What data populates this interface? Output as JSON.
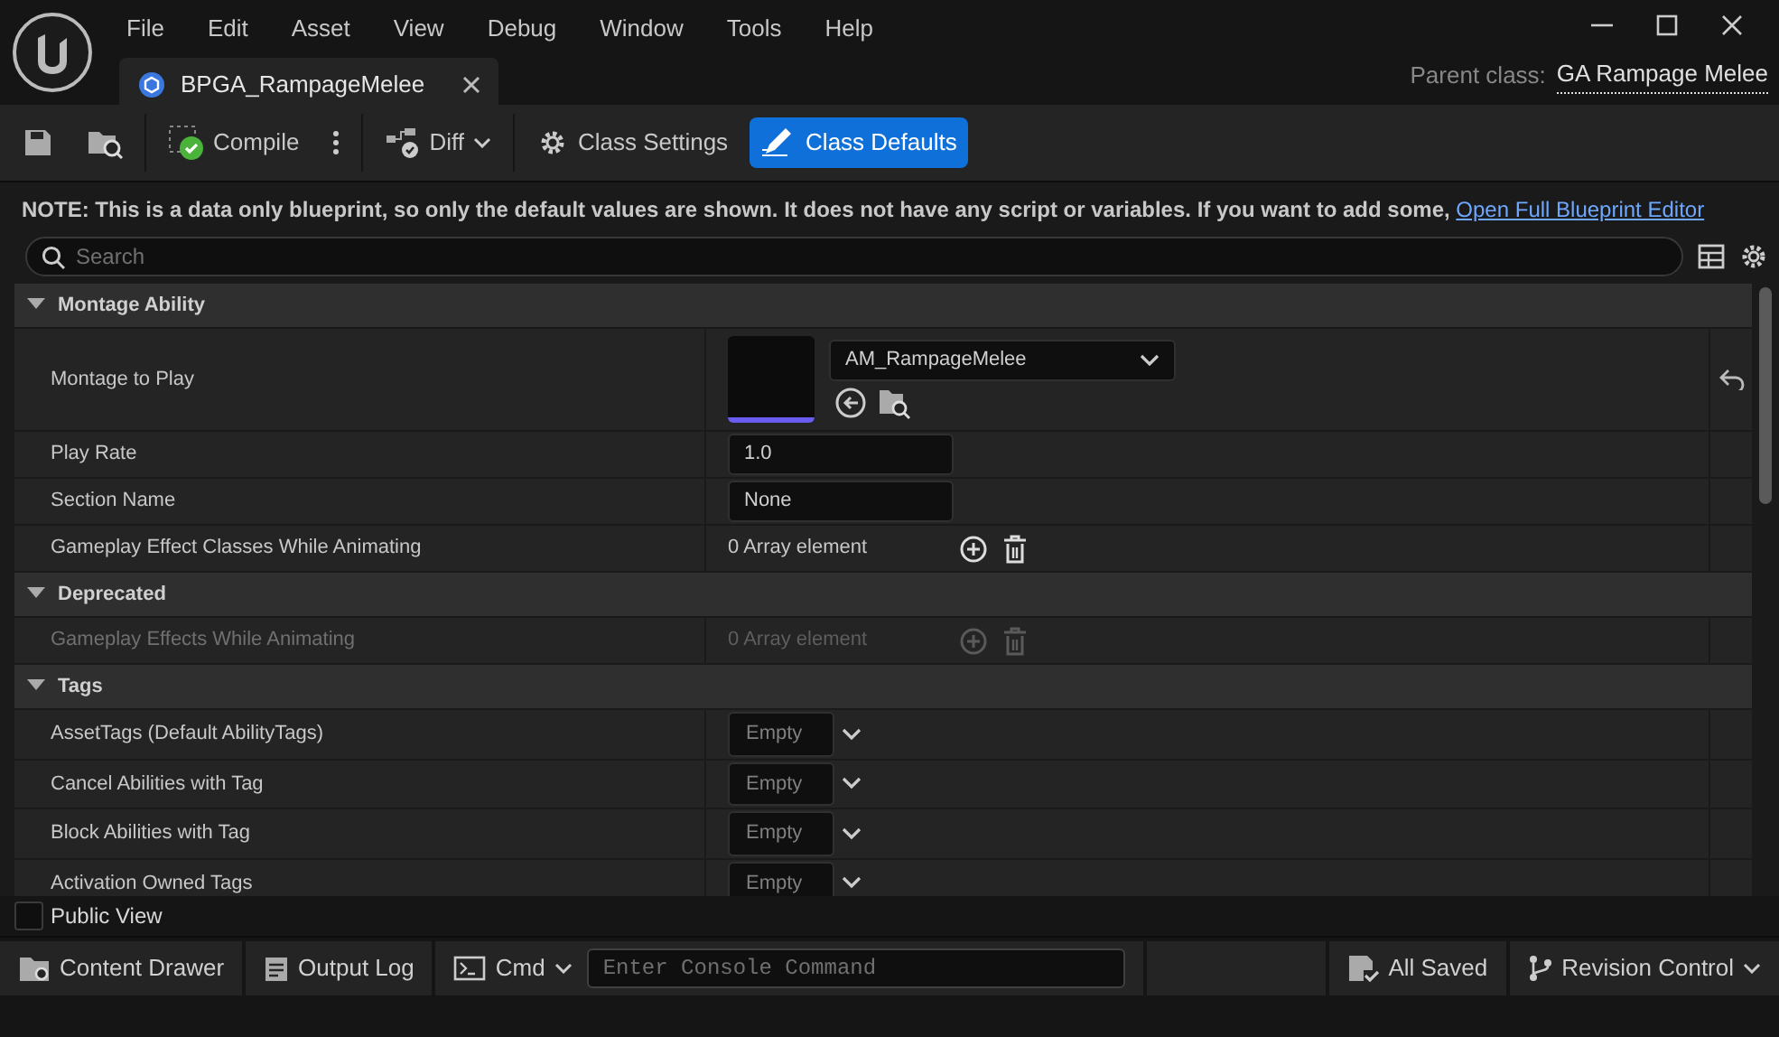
{
  "menu": [
    "File",
    "Edit",
    "Asset",
    "View",
    "Debug",
    "Window",
    "Tools",
    "Help"
  ],
  "tab": {
    "title": "BPGA_RampageMelee"
  },
  "parent_class": {
    "label": "Parent class:",
    "value": "GA Rampage Melee"
  },
  "toolbar": {
    "compile": "Compile",
    "diff": "Diff",
    "modes": [
      {
        "label": "Class Settings",
        "selected": false
      },
      {
        "label": "Class Defaults",
        "selected": true
      }
    ]
  },
  "note": {
    "text": "NOTE: This is a data only blueprint, so only the default values are shown.  It does not have any script or variables.  If you want to add some,",
    "link": "Open Full Blueprint Editor"
  },
  "search": {
    "placeholder": "Search"
  },
  "categories": [
    {
      "name": "Montage Ability",
      "expanded": true,
      "rows": [
        {
          "label": "Montage to Play",
          "kind": "asset",
          "value": "AM_RampageMelee",
          "disabled": false
        },
        {
          "label": "Play Rate",
          "kind": "number",
          "value": "1.0",
          "disabled": false
        },
        {
          "label": "Section Name",
          "kind": "text",
          "value": "None",
          "disabled": false
        },
        {
          "label": "Gameplay Effect Classes While Animating",
          "kind": "array",
          "value": "0 Array element",
          "disabled": false
        }
      ]
    },
    {
      "name": "Deprecated",
      "expanded": true,
      "rows": [
        {
          "label": "Gameplay Effects While Animating",
          "kind": "array",
          "value": "0 Array element",
          "disabled": true
        }
      ]
    },
    {
      "name": "Tags",
      "expanded": true,
      "rows": [
        {
          "label": "AssetTags (Default AbilityTags)",
          "kind": "tags",
          "value": "Empty",
          "disabled": false
        },
        {
          "label": "Cancel Abilities with Tag",
          "kind": "tags",
          "value": "Empty",
          "disabled": false
        },
        {
          "label": "Block Abilities with Tag",
          "kind": "tags",
          "value": "Empty",
          "disabled": false
        },
        {
          "label": "Activation Owned Tags",
          "kind": "tags",
          "value": "Empty",
          "disabled": false
        }
      ]
    }
  ],
  "public_view": {
    "label": "Public View",
    "checked": false
  },
  "status_bar": {
    "content_drawer": "Content Drawer",
    "output_log": "Output Log",
    "cmd": "Cmd",
    "console": {
      "placeholder": "Enter Console Command"
    },
    "all_saved": "All Saved",
    "revision_control": "Revision Control"
  }
}
